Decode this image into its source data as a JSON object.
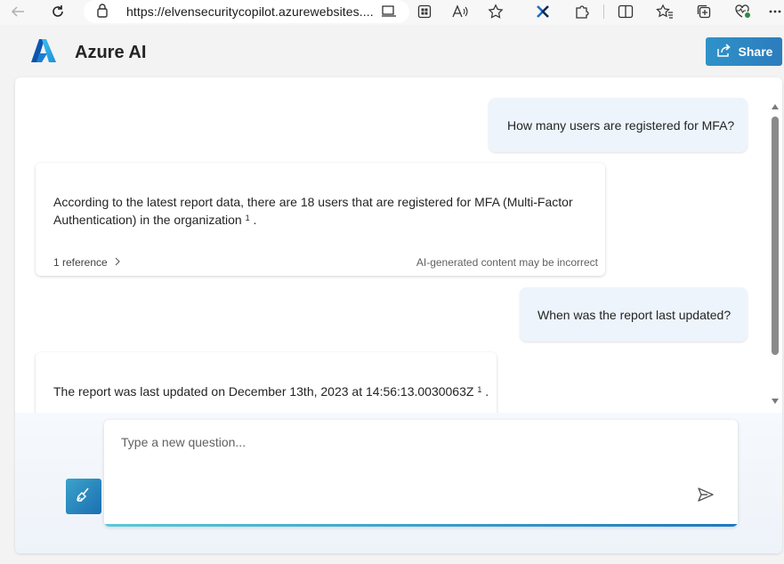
{
  "browser": {
    "url": "https://elvensecuritycopilot.azurewebsites...."
  },
  "header": {
    "title": "Azure AI",
    "share_label": "Share"
  },
  "messages": [
    {
      "role": "user",
      "text": "How many users are registered for MFA?"
    },
    {
      "role": "assistant",
      "text_line1": "According to the latest report data, there are 18 users that are registered for MFA (Multi-Factor",
      "text_line2": "Authentication) in the organization",
      "citation": "1",
      "suffix": ".",
      "reference_label": "1 reference",
      "disclaimer": "AI-generated content may be incorrect"
    },
    {
      "role": "user",
      "text": "When was the report last updated?"
    },
    {
      "role": "assistant",
      "text": "The report was last updated on December 13th, 2023 at 14:56:13.0030063Z",
      "citation": "1",
      "suffix": "."
    }
  ],
  "composer": {
    "placeholder": "Type a new question..."
  },
  "colors": {
    "accent": "#2c7cbd",
    "user_bubble": "#edf4fb"
  }
}
